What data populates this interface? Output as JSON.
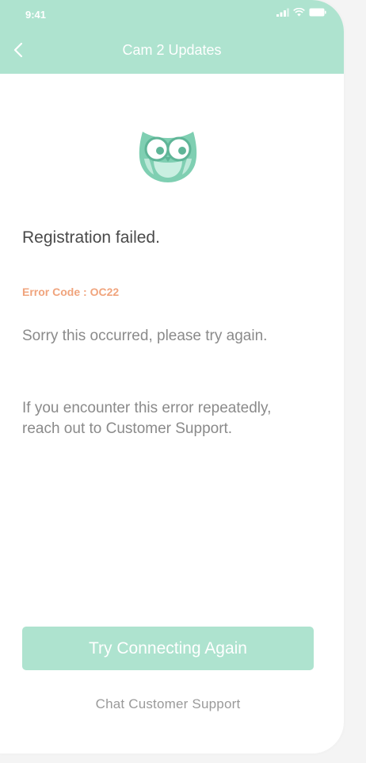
{
  "status_bar": {
    "time": "9:41"
  },
  "header": {
    "title": "Cam 2 Updates"
  },
  "content": {
    "headline": "Registration failed.",
    "error_code": "Error Code : OC22",
    "message_1": "Sorry this occurred, please try again.",
    "message_2": "If you encounter this error repeatedly, reach out to Customer Support."
  },
  "actions": {
    "primary_label": "Try Connecting Again",
    "secondary_label": "Chat Customer Support"
  },
  "icons": {
    "back": "chevron-left-icon",
    "signal": "signal-icon",
    "wifi": "wifi-icon",
    "battery": "battery-icon",
    "logo": "owl-logo-icon"
  },
  "colors": {
    "brand_mint": "#aee3cf",
    "error_orange": "#f0a47d",
    "owl_green": "#7fcfb2"
  }
}
